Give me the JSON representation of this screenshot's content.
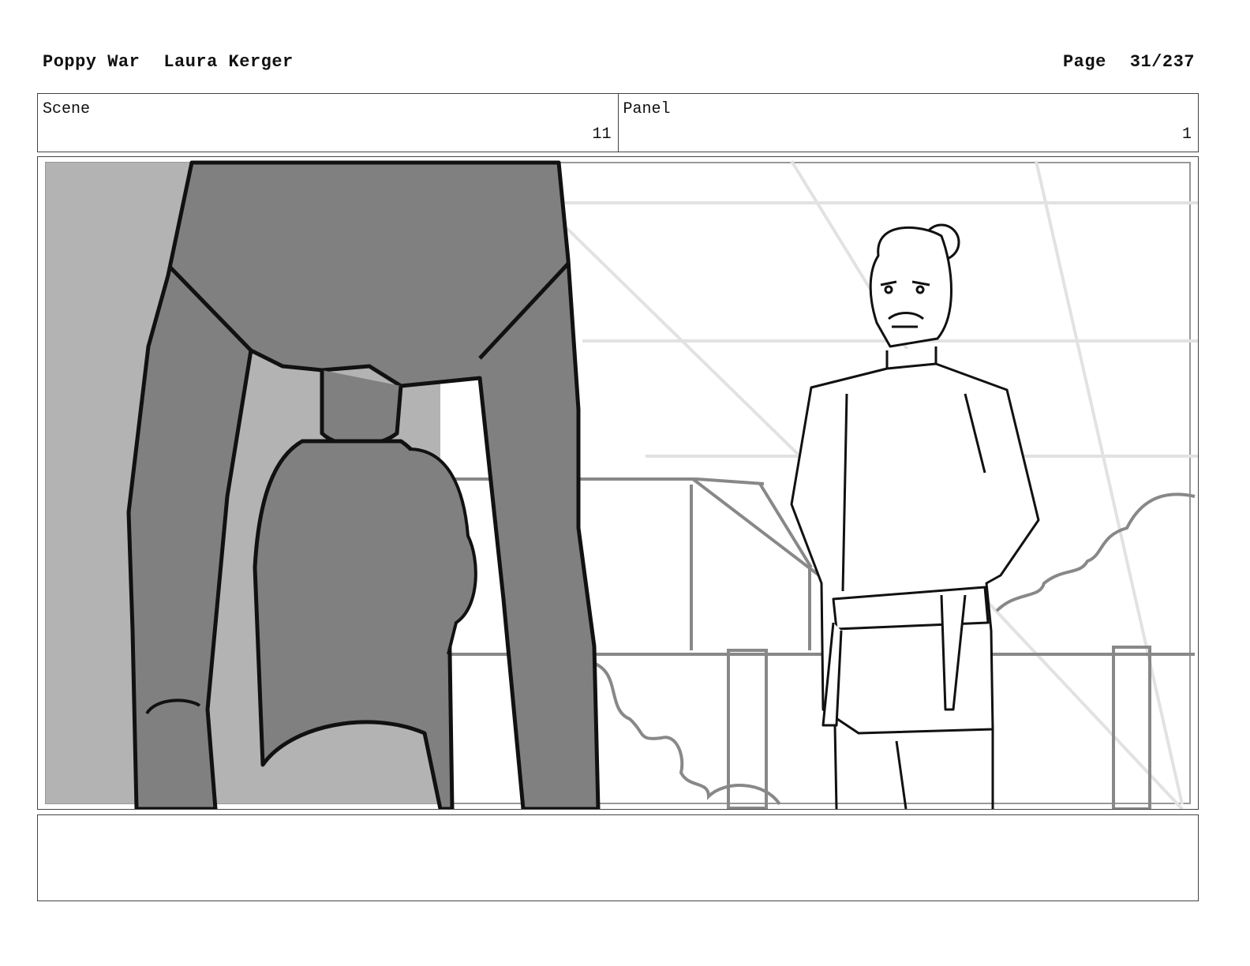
{
  "header": {
    "title": "Poppy War",
    "author": "Laura Kerger",
    "page_label": "Page",
    "page_number": "31/237"
  },
  "info": {
    "scene_label": "Scene",
    "scene_value": "11",
    "panel_label": "Panel",
    "panel_value": "1"
  },
  "panel_art": {
    "description_icon": "storyboard-sketch-image"
  },
  "colors": {
    "foreground_gray": "#808080",
    "mid_gray": "#b3b3b3",
    "line": "#111111",
    "light_line": "#dcdcdc"
  }
}
